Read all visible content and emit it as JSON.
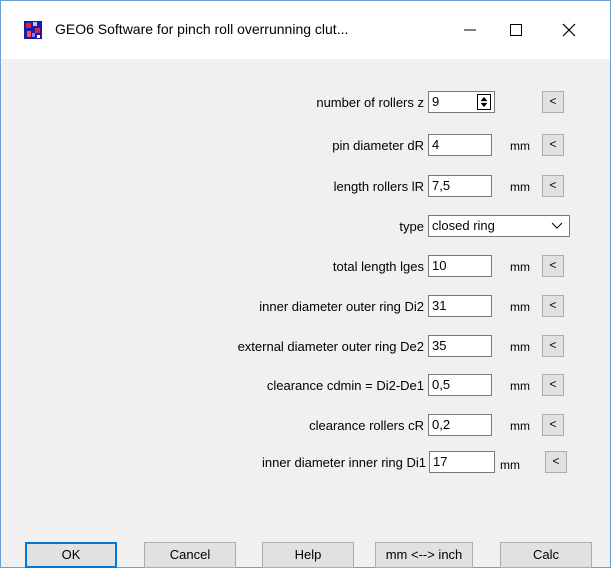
{
  "window": {
    "title": "GEO6  Software for pinch roll overrunning clut...",
    "minimize_symbol": "—",
    "maximize_symbol": "☐",
    "close_symbol": "✕"
  },
  "fields": [
    {
      "label": "number of rollers z",
      "value": "9",
      "unit": "",
      "control": "spinner",
      "button": "<"
    },
    {
      "label": "pin diameter dR",
      "value": "4",
      "unit": "mm",
      "control": "input",
      "button": "<"
    },
    {
      "label": "length rollers lR",
      "value": "7,5",
      "unit": "mm",
      "control": "input",
      "button": "<"
    },
    {
      "label": "type",
      "value": "closed ring",
      "unit": "",
      "control": "select",
      "button": ""
    },
    {
      "label": "total length lges",
      "value": "10",
      "unit": "mm",
      "control": "input",
      "button": "<"
    },
    {
      "label": "inner diameter outer ring Di2",
      "value": "31",
      "unit": "mm",
      "control": "input",
      "button": "<"
    },
    {
      "label": "external diameter outer ring De2",
      "value": "35",
      "unit": "mm",
      "control": "input",
      "button": "<"
    },
    {
      "label": "clearance cdmin = Di2-De1",
      "value": "0,5",
      "unit": "mm",
      "control": "input",
      "button": "<"
    },
    {
      "label": "clearance rollers cR",
      "value": "0,2",
      "unit": "mm",
      "control": "input",
      "button": "<"
    },
    {
      "label": "inner diameter inner ring Di1",
      "value": "17",
      "unit": "mm",
      "control": "input",
      "button": "<"
    }
  ],
  "buttons": {
    "ok": "OK",
    "cancel": "Cancel",
    "help": "Help",
    "units": "mm <--> inch",
    "calc": "Calc"
  }
}
